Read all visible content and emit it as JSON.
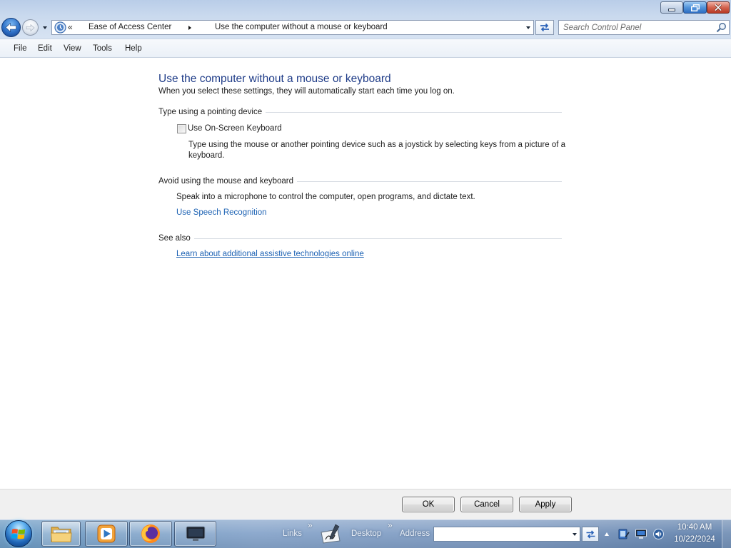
{
  "window": {
    "controls": {
      "minimize": "minimize-icon",
      "restore": "restore-icon",
      "close": "close-icon"
    }
  },
  "nav": {
    "icons": {
      "back": "back-arrow-icon",
      "forward": "forward-arrow-icon",
      "recent_pages": "chevron-down-icon",
      "location": "ease-of-access-icon",
      "breadcrumb_separator": "chevron-right-icon",
      "refresh": "refresh-icon",
      "search": "search-icon"
    },
    "breadcrumb_overflow": "«",
    "breadcrumb": [
      "Ease of Access Center",
      "Use the computer without a mouse or keyboard"
    ],
    "search_placeholder": "Search Control Panel"
  },
  "menu": [
    "File",
    "Edit",
    "View",
    "Tools",
    "Help"
  ],
  "page": {
    "title": "Use the computer without a mouse or keyboard",
    "subtitle": "When you select these settings, they will automatically start each time you log on.",
    "sections": [
      {
        "heading": "Type using a pointing device",
        "option": {
          "label": "Use On-Screen Keyboard",
          "checked": false,
          "description": "Type using the mouse or another pointing device such as a joystick by selecting keys from a picture of a keyboard."
        }
      },
      {
        "heading": "Avoid using the mouse and keyboard",
        "text": "Speak into a microphone to control the computer, open programs, and dictate text.",
        "link": "Use Speech Recognition"
      },
      {
        "heading": "See also",
        "link": "Learn about additional assistive technologies online"
      }
    ]
  },
  "dialog_buttons": {
    "ok": "OK",
    "cancel": "Cancel",
    "apply": "Apply"
  },
  "taskbar": {
    "start_icon": "windows-logo-icon",
    "apps": [
      "folder-icon",
      "media-player-icon",
      "firefox-icon",
      "monitor-icon"
    ],
    "toolbars": {
      "links": "Links",
      "desktop": "Desktop",
      "address": "Address",
      "overflow": "»",
      "quick_launch_icon": "pen-tablet-icon",
      "go_icon": "go-arrows-icon"
    },
    "tray_icons": [
      "chevron-up-icon",
      "tablet-icon",
      "network-icon",
      "volume-icon"
    ],
    "clock": {
      "time": "10:40 AM",
      "date": "10/22/2024"
    }
  },
  "colors": {
    "page_title": "#1f3c88",
    "link": "#1e63b4",
    "close_button": "#c7402e",
    "taskbar": "#7d99c0",
    "button_bar": "#f0f0f0"
  }
}
